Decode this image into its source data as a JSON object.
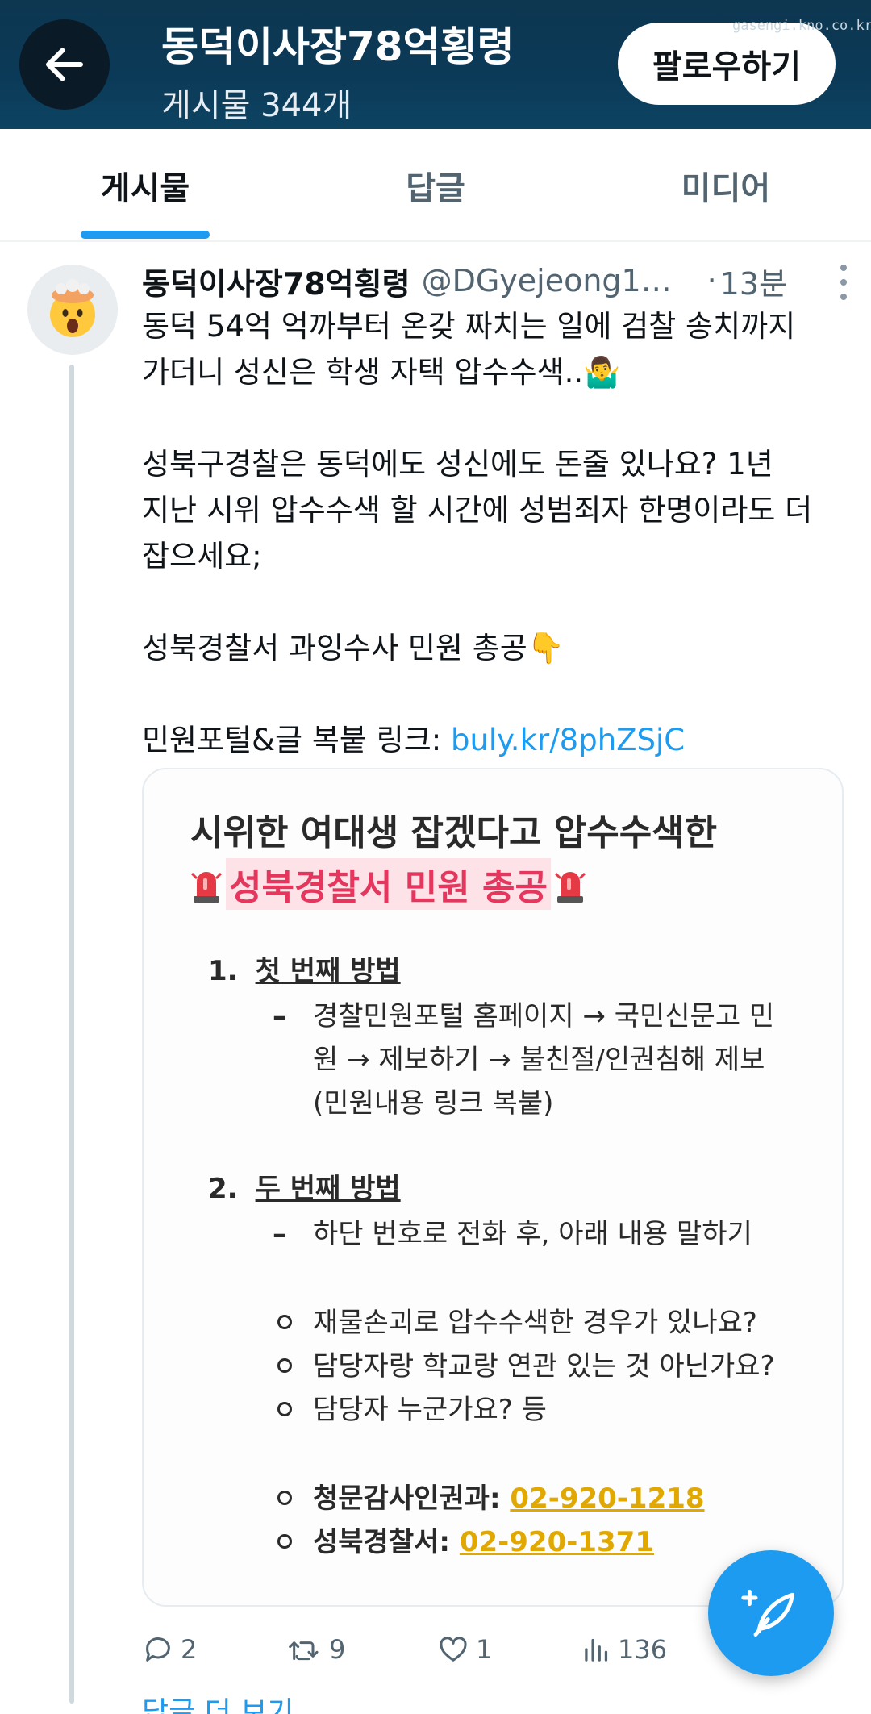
{
  "header": {
    "profile_name": "동덕이사장78억횡령",
    "post_count": "게시물 344개",
    "follow_label": "팔로우하기",
    "watermark": "gasengi.kno.co.kr"
  },
  "tabs": [
    {
      "label": "게시물",
      "active": true
    },
    {
      "label": "답글",
      "active": false
    },
    {
      "label": "미디어",
      "active": false
    }
  ],
  "tweet": {
    "author_name": "동덕이사장78억횡령",
    "author_handle": "@DGyejeong12...",
    "time_sep": "·",
    "time": "13분",
    "lines": {
      "l1": "동덕 54억 억까부터 온갖 짜치는 일에 검찰 송치까지",
      "l2": "가더니 성신은 학생 자택 압수수색..🤷‍♂️",
      "l3": "성북구경찰은 동덕에도 성신에도 돈줄 있나요? 1년",
      "l4": "지난 시위 압수수색 할 시간에 성범죄자 한명이라도 더",
      "l5": "잡으세요;",
      "l6": "성북경찰서 과잉수사 민원 총공👇",
      "l7_prefix": "민원포털&글 복붙 링크: ",
      "l7_link": "buly.kr/8phZSjC"
    },
    "card": {
      "title": "시위한 여대생 잡겠다고 압수수색한",
      "subtitle": "성북경찰서 민원 총공",
      "method1": {
        "num": "1.",
        "title": "첫 번째 방법",
        "dash": "–",
        "lines": [
          "경찰민원포털 홈페이지 → 국민신문고 민",
          "원 → 제보하기 → 불친절/인권침해 제보",
          "(민원내용 링크 복붙)"
        ]
      },
      "method2": {
        "num": "2.",
        "title": "두 번째 방법",
        "dash": "–",
        "line": "하단 번호로 전화 후, 아래 내용 말하기",
        "questions": [
          "재물손괴로 압수수색한 경우가 있나요?",
          "담당자랑 학교랑 연관 있는 것 아닌가요?",
          "담당자 누군가요? 등"
        ],
        "phones": [
          {
            "label": "청문감사인권과: ",
            "number": "02-920-1218"
          },
          {
            "label": "성북경찰서: ",
            "number": "02-920-1371"
          }
        ]
      }
    },
    "stats": {
      "replies": "2",
      "retweets": "9",
      "likes": "1",
      "views": "136"
    }
  },
  "more_replies": "답글 더 보기",
  "colors": {
    "header_bg": "#0b3a58",
    "accent": "#1d9bf0",
    "highlight_text": "#e5365e",
    "phone_color": "#e0a800"
  },
  "icons": [
    "back-arrow-icon",
    "more-options-icon",
    "reply-icon",
    "retweet-icon",
    "like-icon",
    "views-icon",
    "compose-icon",
    "siren-icon"
  ]
}
